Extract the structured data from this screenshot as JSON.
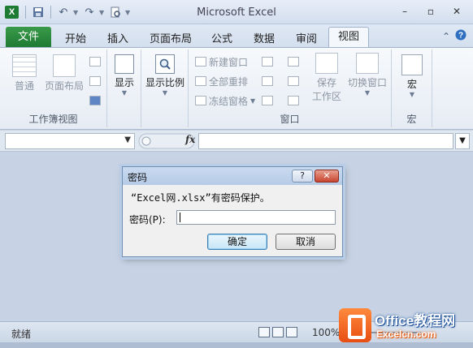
{
  "window": {
    "title": "Microsoft Excel",
    "app_icon_letter": "X",
    "controls": {
      "minimize": "–",
      "restore": "▫",
      "close": "✕"
    }
  },
  "qat": {
    "save_icon": "save-icon",
    "undo_icon": "undo-icon",
    "redo_icon": "redo-icon",
    "preview_icon": "print-preview-icon"
  },
  "tabs": {
    "file": "文件",
    "items": [
      "开始",
      "插入",
      "页面布局",
      "公式",
      "数据",
      "审阅"
    ],
    "active": "视图"
  },
  "ribbon": {
    "workbook_views": {
      "label": "工作簿视图",
      "normal": "普通",
      "page_layout": "页面布局"
    },
    "show": {
      "label": "显示"
    },
    "zoom": {
      "label": "显示比例"
    },
    "window": {
      "label": "窗口",
      "new_window": "新建窗口",
      "arrange_all": "全部重排",
      "freeze_panes": "冻结窗格",
      "save_workspace_1": "保存",
      "save_workspace_2": "工作区",
      "switch_windows": "切换窗口"
    },
    "macros": {
      "label": "宏",
      "button": "宏"
    }
  },
  "formula_bar": {
    "fx": "fx"
  },
  "dialog": {
    "title": "密码",
    "help": "?",
    "close": "✕",
    "message": "“Excel网.xlsx”有密码保护。",
    "password_label": "密码(P):",
    "ok": "确定",
    "cancel": "取消"
  },
  "status": {
    "text": "就绪",
    "zoom": "100%"
  },
  "watermark": {
    "name": "Office教程网",
    "url": "Excelcn.com"
  }
}
